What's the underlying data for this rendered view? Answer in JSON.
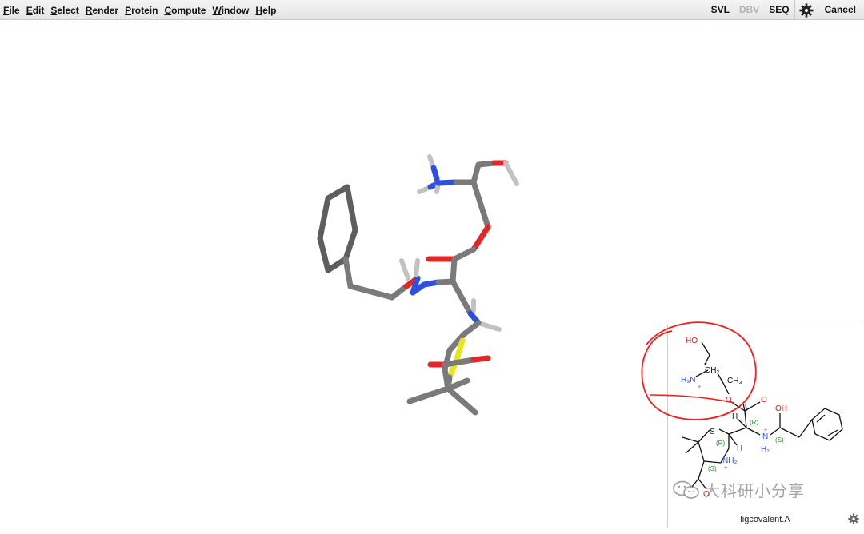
{
  "menu": {
    "items": [
      {
        "first": "F",
        "rest": "ile"
      },
      {
        "first": "E",
        "rest": "dit"
      },
      {
        "first": "S",
        "rest": "elect"
      },
      {
        "first": "R",
        "rest": "ender"
      },
      {
        "first": "P",
        "rest": "rotein"
      },
      {
        "first": "C",
        "rest": "ompute"
      },
      {
        "first": "W",
        "rest": "indow"
      },
      {
        "first": "H",
        "rest": "elp"
      }
    ]
  },
  "toolbar": {
    "svl": "SVL",
    "dbv": "DBV",
    "seq": "SEQ",
    "cancel": "Cancel",
    "settings_icon": "gear-icon"
  },
  "panel": {
    "label": "ligcovalent.A",
    "settings_icon": "gear-icon"
  },
  "diagram2d": {
    "atoms": {
      "ho1": "HO",
      "h3n": "H₃N",
      "ch2": "CH₂",
      "ch3": "CH₃",
      "plus_a": "+",
      "plus_b": "+",
      "plus_c": "+",
      "o_link": "O",
      "o_carbonyl": "O",
      "oh": "OH",
      "s": "S",
      "n_ring": "NH₂",
      "n_plus_ring": "+",
      "n_chain": "N",
      "n_chain_h2": "H₂",
      "n_plus_chain": "+",
      "h1": "H",
      "h2": "H",
      "o_bottom": "O"
    },
    "stereo": {
      "r1": "(R)",
      "r2": "(R)",
      "s1": "(S)",
      "s2": "(S)"
    }
  },
  "watermark": {
    "text": "大科研小分享",
    "icon": "wechat-icon"
  },
  "colors": {
    "carbon": "#7a7a7a",
    "oxygen": "#e23030",
    "nitrogen": "#3050e0",
    "sulfur": "#e8e820",
    "hydrogen": "#c8c8c8",
    "annotation": "#ff1a1a",
    "stereo_label": "#2e8b2e"
  }
}
